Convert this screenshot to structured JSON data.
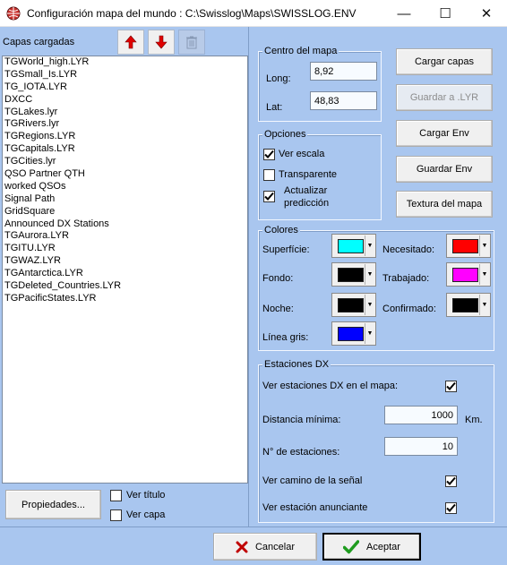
{
  "window": {
    "title": "Configuración mapa del mundo : C:\\Swisslog\\Maps\\SWISSLOG.ENV",
    "minimize": "—",
    "maximize": "☐",
    "close": "✕"
  },
  "layers": {
    "label": "Capas cargadas",
    "up_icon": "arrow-up-icon",
    "down_icon": "arrow-down-icon",
    "delete_icon": "trash-icon",
    "items": [
      "TGWorld_high.LYR",
      "TGSmall_Is.LYR",
      "TG_IOTA.LYR",
      "DXCC",
      "TGLakes.lyr",
      "TGRivers.lyr",
      "TGRegions.LYR",
      "TGCapitals.LYR",
      "TGCities.lyr",
      "QSO Partner QTH",
      "worked QSOs",
      "Signal Path",
      "GridSquare",
      "Announced DX Stations",
      "TGAurora.LYR",
      "TGITU.LYR",
      "TGWAZ.LYR",
      "TGAntarctica.LYR",
      "TGDeleted_Countries.LYR",
      "TGPacificStates.LYR"
    ],
    "properties_button": "Propiedades...",
    "show_title": "Ver título",
    "show_layer": "Ver capa"
  },
  "center": {
    "title": "Centro del mapa",
    "long_label": "Long:",
    "long_value": "8,92",
    "lat_label": "Lat:",
    "lat_value": "48,83"
  },
  "buttons": {
    "load_layers": "Cargar capas",
    "save_lyr": "Guardar a .LYR",
    "load_env": "Cargar Env",
    "save_env": "Guardar Env",
    "texture": "Textura del mapa"
  },
  "options": {
    "title": "Opciones",
    "show_scale": "Ver escala",
    "show_scale_checked": true,
    "transparent": "Transparente",
    "transparent_checked": false,
    "update_prediction_1": "Actualizar",
    "update_prediction_2": "predicción",
    "update_prediction_checked": true
  },
  "colors": {
    "title": "Colores",
    "surface_label": "Superfície:",
    "surface_color": "#00ffff",
    "needed_label": "Necesitado:",
    "needed_color": "#ff0000",
    "background_label": "Fondo:",
    "background_color": "#000000",
    "worked_label": "Trabajado:",
    "worked_color": "#ff00ff",
    "night_label": "Noche:",
    "night_color": "#000000",
    "confirmed_label": "Confirmado:",
    "confirmed_color": "#000000",
    "gray_line_label": "Línea gris:",
    "gray_line_color": "#0000ff"
  },
  "dx": {
    "title": "Estaciones DX",
    "show_on_map": "Ver estaciones DX en el mapa:",
    "min_distance_label": "Distancia mínima:",
    "min_distance_value": "1000",
    "unit": "Km.",
    "num_stations_label": "N° de estaciones:",
    "num_stations_value": "10",
    "signal_path": "Ver camino de la señal",
    "announcing_station": "Ver estación anunciante"
  },
  "footer": {
    "cancel": "Cancelar",
    "accept": "Aceptar"
  }
}
